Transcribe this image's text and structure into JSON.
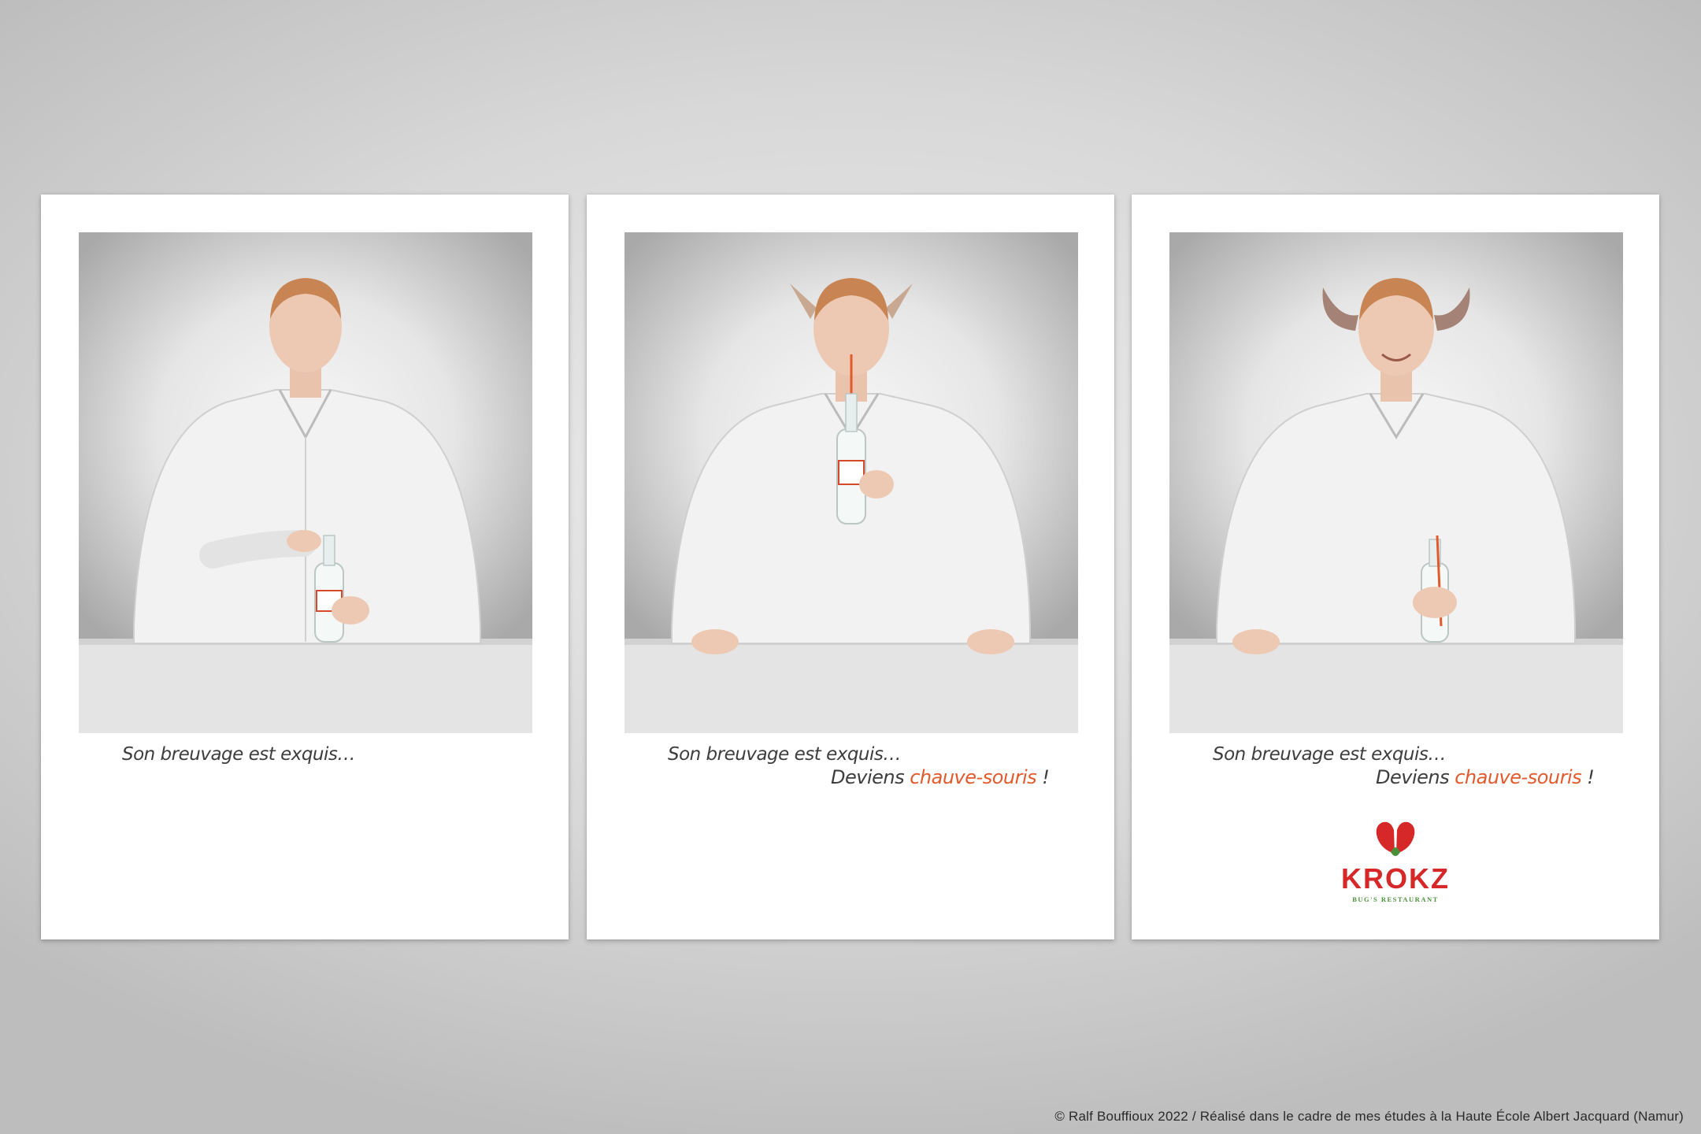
{
  "posters": [
    {
      "photo_alt": "man-opening-bottle",
      "line1": "Son breuvage est exquis…"
    },
    {
      "photo_alt": "man-drinking-with-pointed-ears",
      "line1": "Son breuvage est exquis…",
      "line2_prefix": "Deviens ",
      "line2_accent": "chauve-souris",
      "line2_suffix": " !"
    },
    {
      "photo_alt": "man-smiling-with-bat-ears",
      "line1": "Son breuvage est exquis…",
      "line2_prefix": "Deviens ",
      "line2_accent": "chauve-souris",
      "line2_suffix": " !",
      "logo": {
        "name": "KROKZ",
        "tagline": "BUG'S RESTAURANT",
        "colors": {
          "red": "#d62828",
          "green": "#4a8f3a"
        }
      }
    }
  ],
  "accent_color": "#e25a2c",
  "footer": "© Ralf Bouffioux 2022 / Réalisé dans le cadre de mes études à la Haute École Albert Jacquard (Namur)"
}
